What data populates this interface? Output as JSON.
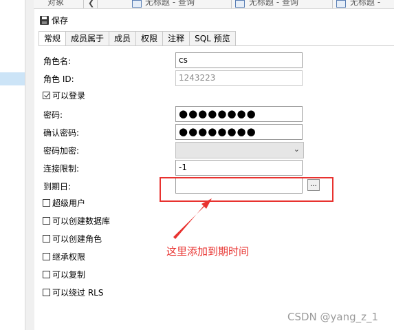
{
  "top_tabs": [
    {
      "label": "对象"
    },
    {
      "label": "无标题 - 查询"
    },
    {
      "label": "无标题 - 查询"
    },
    {
      "label": "无标题 -"
    }
  ],
  "toolbar": {
    "save_label": "保存"
  },
  "tabs": [
    {
      "label": "常规",
      "active": true
    },
    {
      "label": "成员属于"
    },
    {
      "label": "成员"
    },
    {
      "label": "权限"
    },
    {
      "label": "注释"
    },
    {
      "label": "SQL 预览"
    }
  ],
  "form": {
    "role_name_label": "角色名:",
    "role_name_value": "cs",
    "role_id_label": "角色 ID:",
    "role_id_value": "1243223",
    "can_login_label": "可以登录",
    "can_login_checked": true,
    "password_label": "密码:",
    "password_value": "●●●●●●●●",
    "confirm_password_label": "确认密码:",
    "confirm_password_value": "●●●●●●●●",
    "password_encrypt_label": "密码加密:",
    "password_encrypt_value": "",
    "connection_limit_label": "连接限制:",
    "connection_limit_value": "-1",
    "expiry_label": "到期日:",
    "expiry_value": "",
    "expiry_button_label": "...",
    "checkboxes": [
      {
        "label": "超级用户",
        "checked": false
      },
      {
        "label": "可以创建数据库",
        "checked": false
      },
      {
        "label": "可以创建角色",
        "checked": false
      },
      {
        "label": "继承权限",
        "checked": false
      },
      {
        "label": "可以复制",
        "checked": false
      },
      {
        "label": "可以绕过 RLS",
        "checked": false
      }
    ]
  },
  "annotation": {
    "text": "这里添加到期时间",
    "color": "#e8322f"
  },
  "watermark": "CSDN @yang_z_1",
  "icons": {
    "save": "save-icon",
    "pin": "pin-icon",
    "query_tab": "table-grid-icon",
    "dropdown": "chevron-down-icon"
  }
}
